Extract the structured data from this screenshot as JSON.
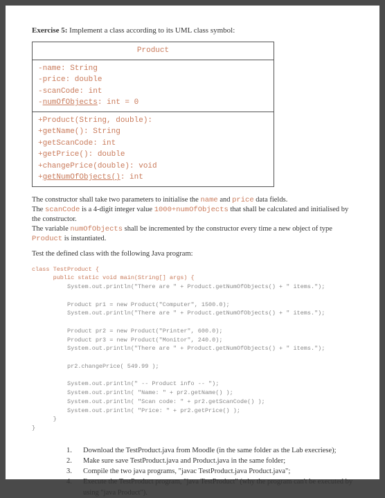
{
  "exercise": {
    "label": "Exercise 5:",
    "intro": " Implement a class according to its UML class symbol:"
  },
  "uml": {
    "title": "Product",
    "attributes": "-name: String\n-price: double\n-scanCode: int\n-numOfObjects: int = 0",
    "attr_underline": "numOfObjects",
    "methods": "+Product(String, double):\n+getName(): String\n+getScanCode: int\n+getPrice(): double\n+changePrice(double): void\n+getNumOfObjects(): int",
    "meth_underline": "getNumOfObjects()"
  },
  "para1": {
    "t1": "The constructor shall take two parameters to initialise the ",
    "c1": "name",
    "t2": " and ",
    "c2": "price",
    "t3": " data fields.",
    "t4": "The ",
    "c3": "scanCode",
    "t5": " is a 4-digit integer value ",
    "c4": "1000+numOfObjects",
    "t6": " that shall be calculated and initialised by the constructor.",
    "t7": "The variable ",
    "c5": "numOfObjects",
    "t8": " shall be incremented by the constructor every time a new object of type ",
    "c6": "Product",
    "t9": " is instantiated."
  },
  "test_line": "Test the defined class with the following Java program:",
  "code": {
    "l1": "class TestProduct {",
    "l2": "      public static void main(String[] args) {",
    "l3": "          System.out.println(\"There are \" + Product.getNumOfObjects() + \" items.\");",
    "l4": "",
    "l5": "          Product pr1 = new Product(\"Computer\", 1500.0);",
    "l6": "          System.out.println(\"There are \" + Product.getNumOfObjects() + \" items.\");",
    "l7": "",
    "l8": "          Product pr2 = new Product(\"Printer\", 600.0);",
    "l9": "          Product pr3 = new Product(\"Monitor\", 240.0);",
    "l10": "          System.out.println(\"There are \" + Product.getNumOfObjects() + \" items.\");",
    "l11": "",
    "l12": "          pr2.changePrice( 549.99 );",
    "l13": "",
    "l14": "          System.out.println(\" -- Product info -- \");",
    "l15": "          System.out.println( \"Name: \" + pr2.getName() );",
    "l16": "          System.out.println( \"Scan code: \" + pr2.getScanCode() );",
    "l17": "          System.out.println( \"Price: \" + pr2.getPrice() );",
    "l18": "      }",
    "l19": "}"
  },
  "steps": [
    "Download the TestProduct.java from Moodle (in the same folder as the Lab execriese);",
    "Make sure save TestProduct.java and Product.java in the same folder;",
    "Compile the two java programs, \"javac TestProduct.java Product.java\";",
    "Execute the TestProduct program, \"java TestProduct\" (why the program can't be executed by using \"java Product\")."
  ]
}
